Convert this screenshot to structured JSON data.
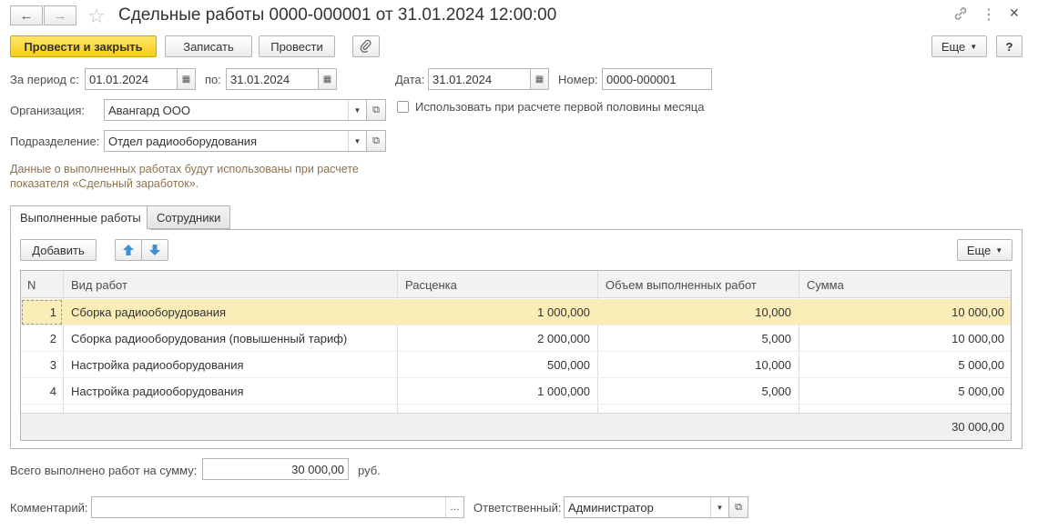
{
  "window": {
    "title": "Сдельные работы 0000-000001 от 31.01.2024 12:00:00"
  },
  "toolbar": {
    "post_close_label": "Провести и закрыть",
    "save_label": "Записать",
    "post_label": "Провести",
    "more_label": "Еще",
    "help_label": "?"
  },
  "header": {
    "period_from_label": "За период с:",
    "period_from_value": "01.01.2024",
    "period_to_label": "по:",
    "period_to_value": "31.01.2024",
    "date_label": "Дата:",
    "date_value": "31.01.2024",
    "number_label": "Номер:",
    "number_value": "0000-000001",
    "organization_label": "Организация:",
    "organization_value": "Авангард ООО",
    "first_half_checkbox_label": "Использовать при расчете первой половины месяца",
    "first_half_checked": false,
    "department_label": "Подразделение:",
    "department_value": "Отдел радиооборудования",
    "info_line1": "Данные о выполненных работах будут использованы при расчете",
    "info_line2": "показателя «Сдельный заработок»."
  },
  "tabs": [
    {
      "label": "Выполненные работы",
      "active": true
    },
    {
      "label": "Сотрудники",
      "active": false
    }
  ],
  "table_toolbar": {
    "add_label": "Добавить",
    "more_label": "Еще"
  },
  "table": {
    "columns": [
      "N",
      "Вид работ",
      "Расценка",
      "Объем выполненных работ",
      "Сумма"
    ],
    "rows": [
      {
        "n": "1",
        "work": "Сборка радиооборудования",
        "rate": "1 000,000",
        "volume": "10,000",
        "sum": "10 000,00"
      },
      {
        "n": "2",
        "work": "Сборка радиооборудования (повышенный тариф)",
        "rate": "2 000,000",
        "volume": "5,000",
        "sum": "10 000,00"
      },
      {
        "n": "3",
        "work": "Настройка радиооборудования",
        "rate": "500,000",
        "volume": "10,000",
        "sum": "5 000,00"
      },
      {
        "n": "4",
        "work": "Настройка радиооборудования",
        "rate": "1 000,000",
        "volume": "5,000",
        "sum": "5 000,00"
      }
    ],
    "total_sum": "30 000,00"
  },
  "footer": {
    "total_label": "Всего выполнено работ на сумму:",
    "total_value": "30 000,00",
    "currency": "руб.",
    "comment_label": "Комментарий:",
    "comment_value": "",
    "responsible_label": "Ответственный:",
    "responsible_value": "Администратор"
  },
  "colors": {
    "accent_yellow": "#f5cf14",
    "selected_row": "#fbedb8",
    "info_text": "#8c7350"
  }
}
